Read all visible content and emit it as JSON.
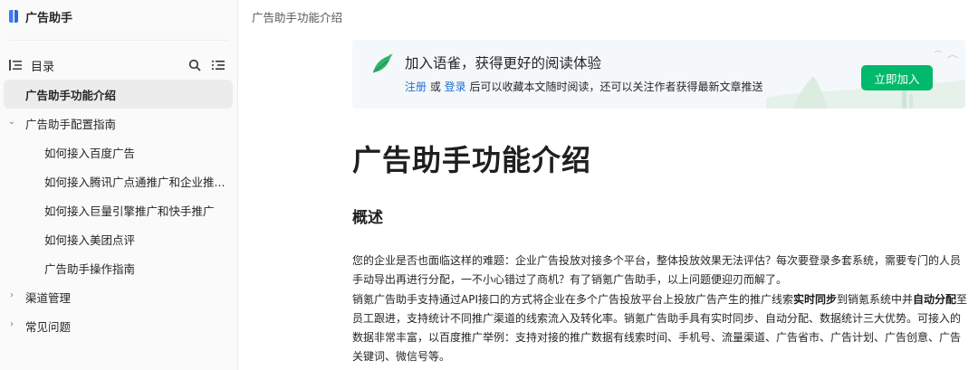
{
  "sidebar": {
    "brand": "广告助手",
    "toc_label": "目录",
    "items": [
      {
        "label": "广告助手功能介绍"
      },
      {
        "label": "广告助手配置指南"
      },
      {
        "label": "如何接入百度广告"
      },
      {
        "label": "如何接入腾讯广点通推广和企业推..."
      },
      {
        "label": "如何接入巨量引擎推广和快手推广"
      },
      {
        "label": "如何接入美团点评"
      },
      {
        "label": "广告助手操作指南"
      },
      {
        "label": "渠道管理"
      },
      {
        "label": "常见问题"
      }
    ]
  },
  "breadcrumb": "广告助手功能介绍",
  "banner": {
    "title": "加入语雀，获得更好的阅读体验",
    "register": "注册",
    "or": " 或 ",
    "login": "登录",
    "rest": " 后可以收藏本文随时阅读，还可以关注作者获得最新文章推送",
    "button": "立即加入",
    "accent_color": "#00b96b"
  },
  "article": {
    "title": "广告助手功能介绍",
    "section": "概述",
    "p1": "您的企业是否也面临这样的难题：企业广告投放对接多个平台，整体投放效果无法评估？每次要登录多套系统，需要专门的人员手动导出再进行分配，一不小心错过了商机？有了销氪广告助手，以上问题便迎刃而解了。",
    "p2a": "销氪广告助手支持通过API接口的方式将企业在多个广告投放平台上投放广告产生的推广线索",
    "p2b": "实时同步",
    "p2c": "到销氪系统中并",
    "p2d": "自动分配",
    "p2e": "至员工跟进，支持统计不同推广渠道的线索流入及转化率。销氪广告助手具有实时同步、自动分配、数据统计三大优势。可接入的数据非常丰富，以百度推广举例：支持对接的推广数据有线索时间、手机号、流量渠道、广告省市、广告计划、广告创意、广告关键词、微信号等。"
  }
}
